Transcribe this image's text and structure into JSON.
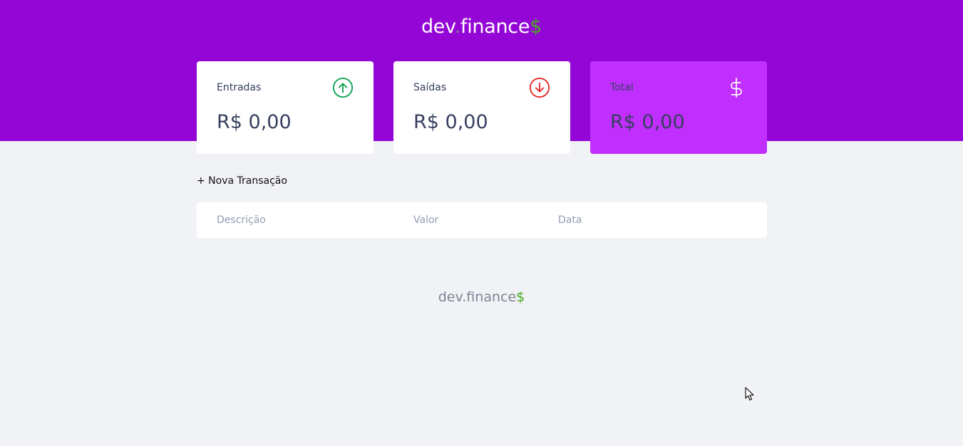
{
  "header": {
    "logo_main": "dev",
    "logo_dot": ".",
    "logo_rest": "finance",
    "logo_dollar": "$"
  },
  "cards": [
    {
      "title": "Entradas",
      "value": "R$ 0,00",
      "icon": "arrow-up-circle-icon",
      "icon_color": "#12a454"
    },
    {
      "title": "Saídas",
      "value": "R$ 0,00",
      "icon": "arrow-down-circle-icon",
      "icon_color": "#e92929"
    },
    {
      "title": "Total",
      "value": "R$ 0,00",
      "icon": "dollar-sign-icon",
      "icon_color": "#ffffff"
    }
  ],
  "actions": {
    "new_transaction": "+ Nova Transação"
  },
  "table": {
    "columns": [
      "Descrição",
      "Valor",
      "Data"
    ]
  },
  "footer": {
    "logo_text": "dev.finance",
    "logo_dollar": "$"
  },
  "colors": {
    "header_bg": "#9406d6",
    "total_card_bg": "#c02ffd",
    "page_bg": "#f0f2f5",
    "accent_green": "#49aa26"
  }
}
